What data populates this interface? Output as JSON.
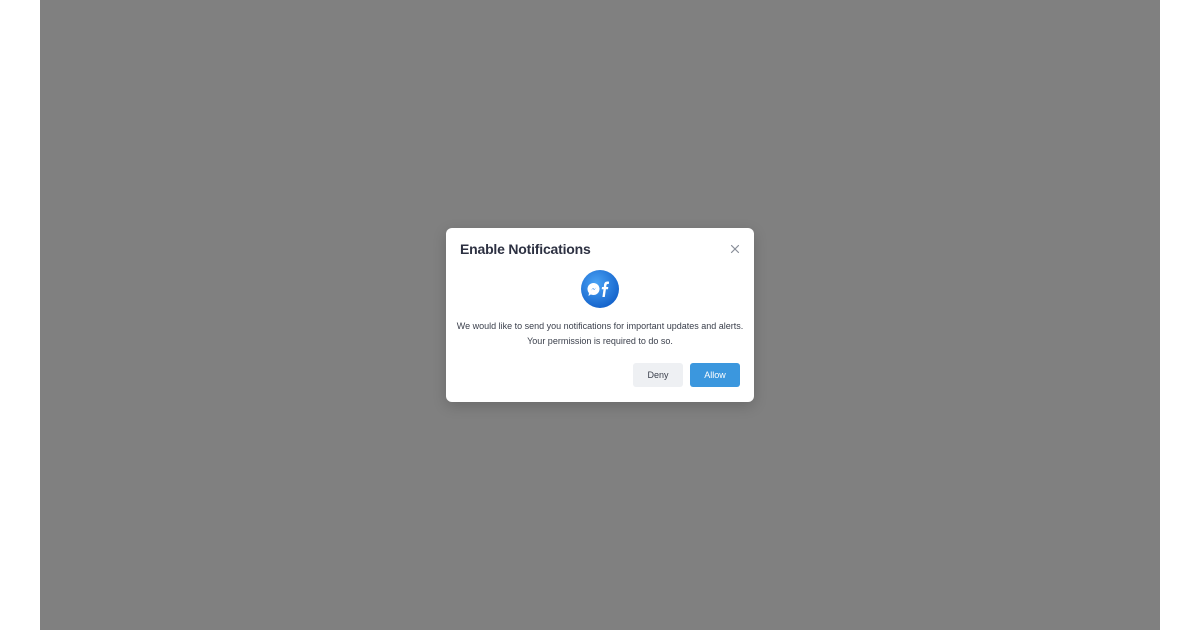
{
  "dialog": {
    "title": "Enable Notifications",
    "message": "We would like to send you notifications for important updates and alerts. Your permission is required to do so.",
    "deny_label": "Deny",
    "allow_label": "Allow",
    "close_icon": "close-icon",
    "logo_icon": "messenger-facebook-logo"
  },
  "colors": {
    "overlay": "#808080",
    "dialog_bg": "#ffffff",
    "title": "#2d3142",
    "allow_bg": "#3b97de",
    "deny_bg": "#eef0f3",
    "logo_blue": "#1877f2"
  }
}
